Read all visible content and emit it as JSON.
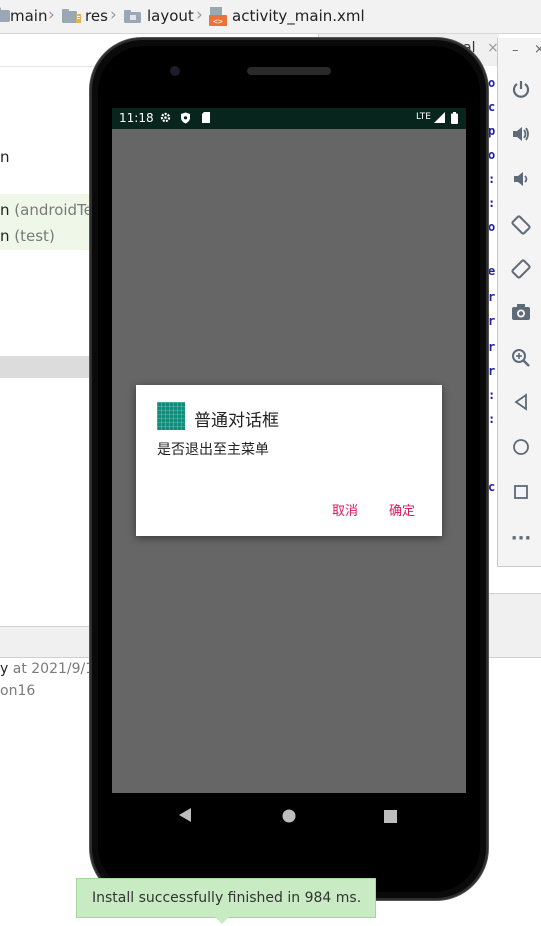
{
  "breadcrumb": {
    "items": [
      "main",
      "res",
      "layout",
      "activity_main.xml"
    ]
  },
  "ide": {
    "left_lines": [
      {
        "main": "n",
        "suffix": ""
      },
      {
        "main": "n ",
        "suffix": "(androidTe"
      },
      {
        "main": "n ",
        "suffix": "(test)"
      }
    ],
    "run_line": {
      "main": "y ",
      "suffix": "at 2021/9/1"
    },
    "run_line2": "on16",
    "tab_label": "al",
    "code_chars": [
      "o",
      "c",
      "p",
      "o",
      ":",
      ":",
      "o",
      "e",
      "r",
      "r",
      "r",
      "r",
      ":",
      ":",
      "c"
    ]
  },
  "phone": {
    "status": {
      "time": "11:18",
      "network": "LTE"
    },
    "dialog": {
      "title": "普通对话框",
      "message": "是否退出至主菜单",
      "negative": "取消",
      "positive": "确定"
    }
  },
  "emulator_toolbar": {
    "icons": [
      "power-icon",
      "volume-up-icon",
      "volume-down-icon",
      "rotate-left-icon",
      "rotate-right-icon",
      "camera-icon",
      "zoom-icon",
      "back-icon",
      "home-icon",
      "overview-icon",
      "more-icon"
    ]
  },
  "toast": {
    "message": "Install successfully finished in 984 ms."
  },
  "colors": {
    "dialog_accent": "#d81b60",
    "status_bar": "#07241d",
    "screen_bg": "#666666",
    "app_icon": "#0d8f7c"
  }
}
